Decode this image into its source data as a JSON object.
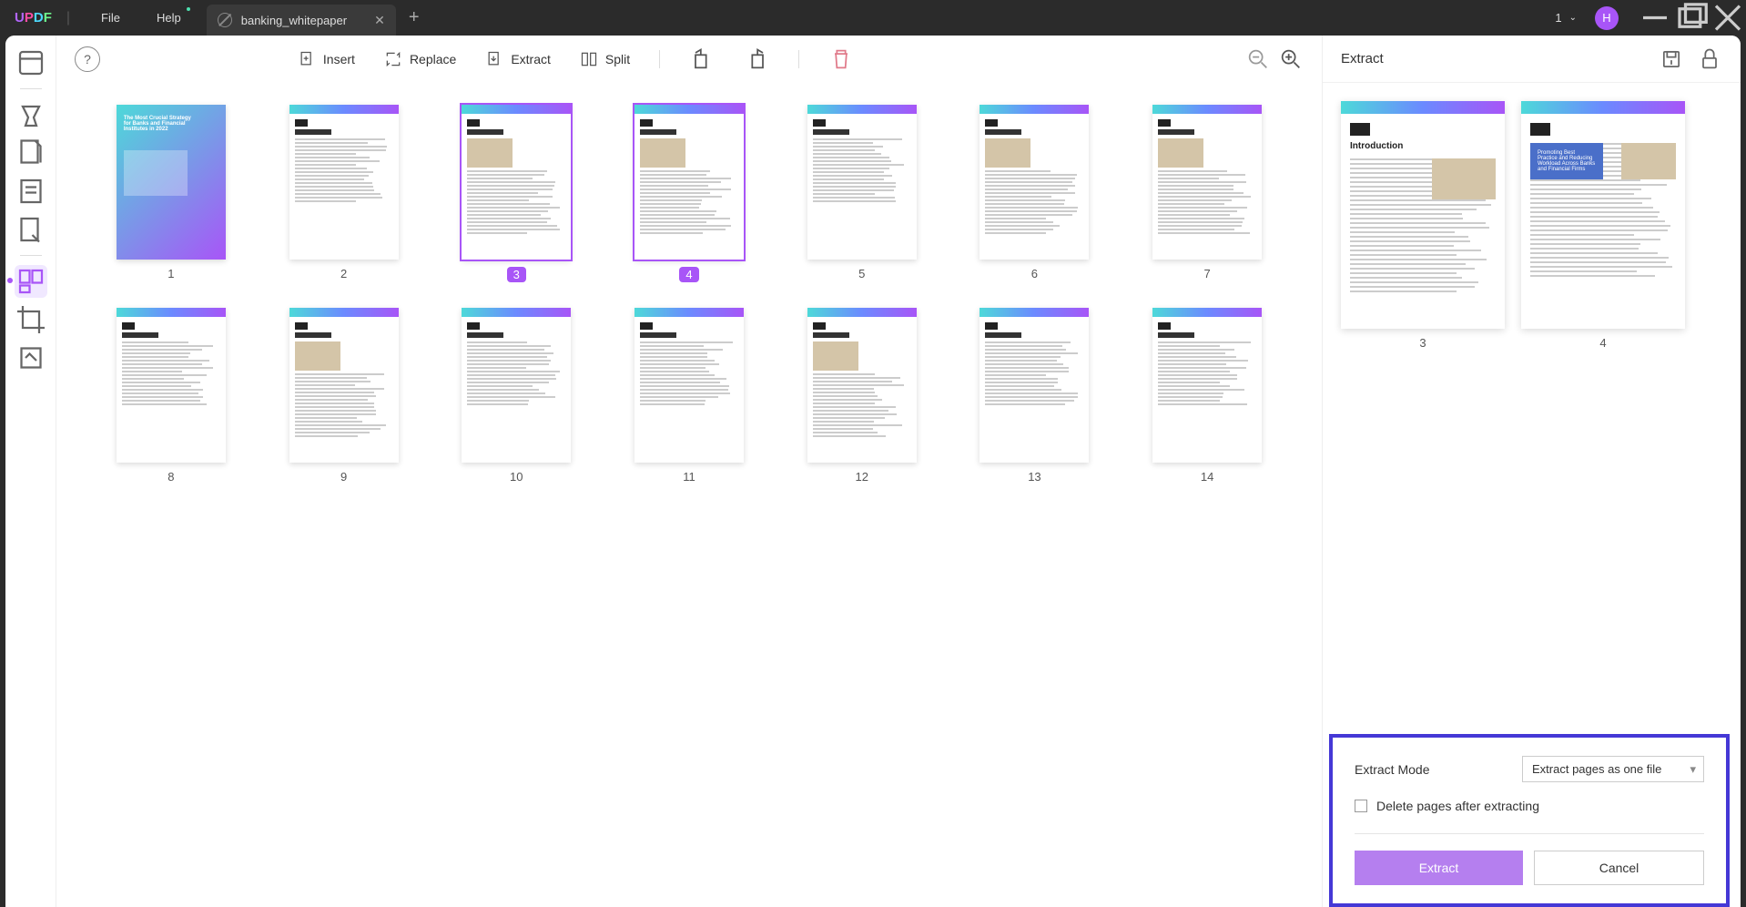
{
  "titlebar": {
    "logo": "UPDF",
    "menu": {
      "file": "File",
      "help": "Help"
    },
    "tab": {
      "title": "banking_whitepaper"
    },
    "page_indicator": "1",
    "avatar_letter": "H"
  },
  "toolbar": {
    "insert": "Insert",
    "replace": "Replace",
    "extract": "Extract",
    "split": "Split"
  },
  "pages": [
    {
      "num": "1",
      "selected": false
    },
    {
      "num": "2",
      "selected": false
    },
    {
      "num": "3",
      "selected": true
    },
    {
      "num": "4",
      "selected": true
    },
    {
      "num": "5",
      "selected": false
    },
    {
      "num": "6",
      "selected": false
    },
    {
      "num": "7",
      "selected": false
    },
    {
      "num": "8",
      "selected": false
    },
    {
      "num": "9",
      "selected": false
    },
    {
      "num": "10",
      "selected": false
    },
    {
      "num": "11",
      "selected": false
    },
    {
      "num": "12",
      "selected": false
    },
    {
      "num": "13",
      "selected": false
    },
    {
      "num": "14",
      "selected": false
    }
  ],
  "right_panel": {
    "title": "Extract",
    "thumbs": [
      {
        "num": "3"
      },
      {
        "num": "4"
      }
    ]
  },
  "extract_box": {
    "mode_label": "Extract Mode",
    "mode_value": "Extract pages as one file",
    "delete_label": "Delete pages after extracting",
    "extract_btn": "Extract",
    "cancel_btn": "Cancel"
  }
}
